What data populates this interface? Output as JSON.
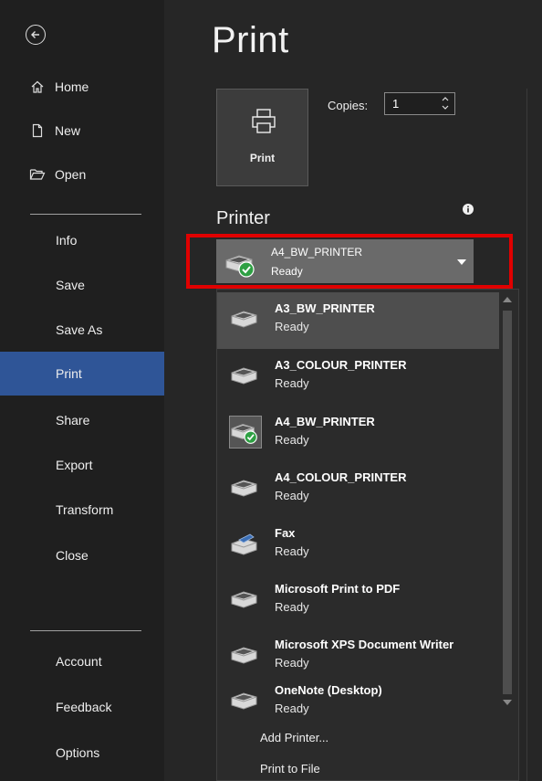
{
  "page": {
    "title": "Print"
  },
  "nav": {
    "top": [
      {
        "label": "Home",
        "icon": "home-icon"
      },
      {
        "label": "New",
        "icon": "new-document-icon"
      },
      {
        "label": "Open",
        "icon": "folder-open-icon"
      }
    ],
    "middle": [
      "Info",
      "Save",
      "Save As",
      "Print",
      "Share",
      "Export",
      "Transform",
      "Close"
    ],
    "bottom": [
      "Account",
      "Feedback",
      "Options"
    ],
    "selected": "Print"
  },
  "print_button": {
    "label": "Print"
  },
  "copies": {
    "label": "Copies:",
    "value": "1"
  },
  "printer": {
    "heading": "Printer",
    "selected": {
      "name": "A4_BW_PRINTER",
      "status": "Ready"
    },
    "list": [
      {
        "name": "A3_BW_PRINTER",
        "status": "Ready"
      },
      {
        "name": "A3_COLOUR_PRINTER",
        "status": "Ready"
      },
      {
        "name": "A4_BW_PRINTER",
        "status": "Ready"
      },
      {
        "name": "A4_COLOUR_PRINTER",
        "status": "Ready"
      },
      {
        "name": "Fax",
        "status": "Ready"
      },
      {
        "name": "Microsoft Print to PDF",
        "status": "Ready"
      },
      {
        "name": "Microsoft XPS Document Writer",
        "status": "Ready"
      },
      {
        "name": "OneNote (Desktop)",
        "status": "Ready"
      }
    ],
    "actions": [
      "Add Printer...",
      "Print to File"
    ]
  },
  "colors": {
    "selected_nav": "#2f5597",
    "highlight": "#e00000",
    "default_check": "#2ea043"
  }
}
